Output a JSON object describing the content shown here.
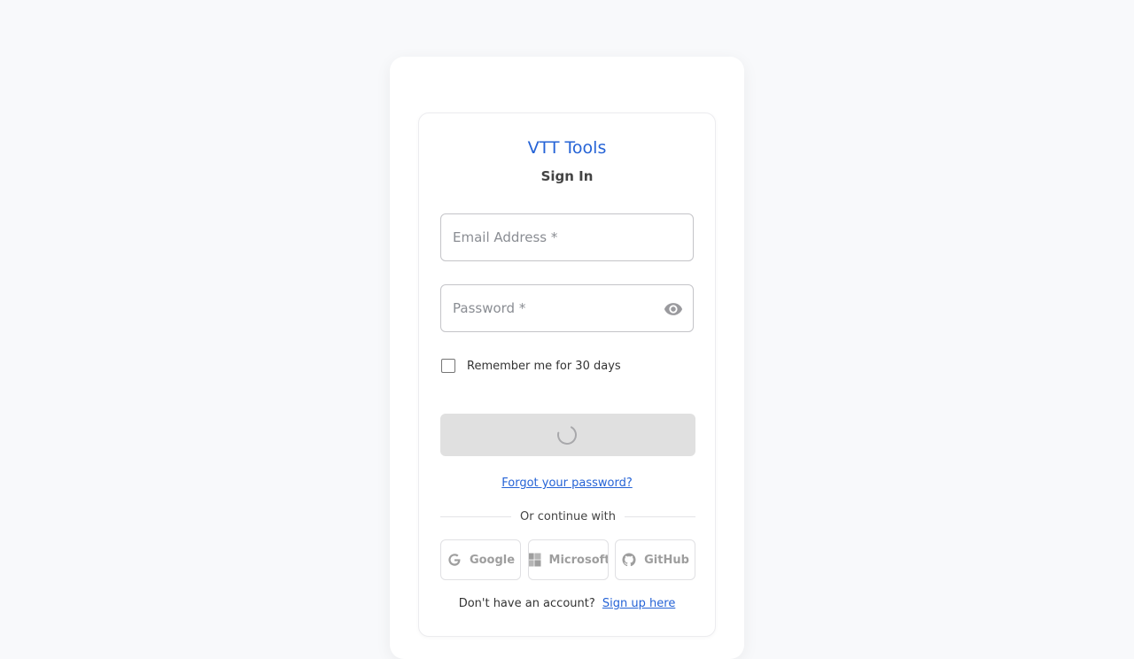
{
  "app": {
    "brand": "VTT Tools",
    "subtitle": "Sign In"
  },
  "form": {
    "email": {
      "placeholder": "Email Address *",
      "value": ""
    },
    "password": {
      "placeholder": "Password *",
      "value": ""
    },
    "remember_label": "Remember me for 30 days",
    "remember_checked": false,
    "submit_state": "loading",
    "forgot_link": "Forgot your password?"
  },
  "social": {
    "divider_text": "Or continue with",
    "providers": [
      {
        "label": "Google",
        "icon": "google-icon"
      },
      {
        "label": "Microsoft",
        "icon": "microsoft-icon"
      },
      {
        "label": "GitHub",
        "icon": "github-icon"
      }
    ]
  },
  "signup": {
    "prompt": "Don't have an account?",
    "link": "Sign up here"
  },
  "colors": {
    "accent": "#2563d6",
    "page_background": "#f8f9fb",
    "disabled_button": "#e0e0e0",
    "muted_text": "#9e9e9e"
  }
}
